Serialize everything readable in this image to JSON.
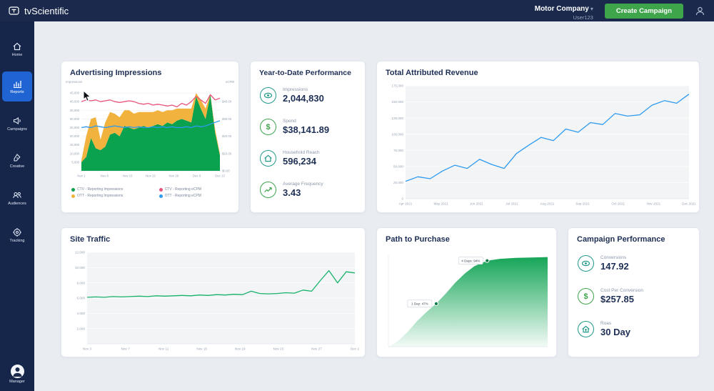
{
  "colors": {
    "topbar_navy": "#1b2a4c",
    "sidebar_navy": "#16264b",
    "active_blue": "#2064d4",
    "button_green": "#3fa54a",
    "icon_teal": "#21998a",
    "icon_green": "#3ea34d",
    "chart_green": "#0aa14f",
    "chart_yellow": "#f2b23e",
    "chart_pink": "#e8537a",
    "chart_blue": "#2e9bf0",
    "background": "#e9edf2"
  },
  "topbar": {
    "brand": "tvScientific",
    "account_name": "Motor Company",
    "account_user": "User123",
    "create_campaign_label": "Create Campaign"
  },
  "sidebar": {
    "items": [
      {
        "label": "Home",
        "active": false
      },
      {
        "label": "Reports",
        "active": true
      },
      {
        "label": "Campaigns",
        "active": false
      },
      {
        "label": "Creative",
        "active": false
      },
      {
        "label": "Audiences",
        "active": false
      },
      {
        "label": "Tracking",
        "active": false
      }
    ],
    "manager_label": "Manager"
  },
  "ytd": {
    "title": "Year-to-Date Performance",
    "stats": [
      {
        "label": "Impressions",
        "value": "2,044,830",
        "icon": "eye"
      },
      {
        "label": "Spend",
        "value": "$38,141.89",
        "icon": "dollar"
      },
      {
        "label": "Household Reach",
        "value": "596,234",
        "icon": "house"
      },
      {
        "label": "Average Frequency",
        "value": "3.43",
        "icon": "trend"
      }
    ]
  },
  "campaign_performance": {
    "title": "Campaign Performance",
    "stats": [
      {
        "label": "Conversions",
        "value": "147.92",
        "icon": "eye"
      },
      {
        "label": "Cost Per Conversion",
        "value": "$257.85",
        "icon": "dollar"
      },
      {
        "label": "Roas",
        "value": "30 Day",
        "icon": "house-up"
      }
    ]
  },
  "chart_data": {
    "advertising_impressions": {
      "type": "area+line",
      "title": "Advertising Impressions",
      "ylabel_left": "Impressions",
      "ylabel_right": "eCPM",
      "x_ticks": [
        "Nov 1",
        "Nov 8",
        "Nov 15",
        "Nov 22",
        "Nov 29",
        "Dec 6",
        "Dec 13"
      ],
      "y_left": {
        "min": 0,
        "max": 50000,
        "ticks": [
          {
            "v": 5000,
            "label": "5,000"
          },
          {
            "v": 10000,
            "label": "10,000"
          },
          {
            "v": 15000,
            "label": "15,000"
          },
          {
            "v": 20000,
            "label": "20,000"
          },
          {
            "v": 25000,
            "label": "25,000"
          },
          {
            "v": 30000,
            "label": "30,000"
          },
          {
            "v": 35000,
            "label": "35,000"
          },
          {
            "v": 40000,
            "label": "40,000"
          },
          {
            "v": 45000,
            "label": "45,000"
          }
        ]
      },
      "y_right": {
        "min": 0,
        "max": 50,
        "ticks": [
          {
            "v": 0,
            "label": "$0.00"
          },
          {
            "v": 10,
            "label": "$10.00"
          },
          {
            "v": 20,
            "label": "$20.00"
          },
          {
            "v": 30,
            "label": "$30.00"
          },
          {
            "v": 40,
            "label": "$40.00"
          }
        ]
      },
      "series": [
        {
          "name": "CTV - Reporting Impressions",
          "type": "area",
          "stack": true,
          "color": "#0aa14f",
          "values": [
            5000,
            8000,
            19000,
            13000,
            12000,
            14000,
            21000,
            22000,
            20000,
            26000,
            25000,
            24000,
            25000,
            26000,
            25000,
            26000,
            27000,
            26000,
            28000,
            27000,
            29000,
            30000,
            29000,
            28000,
            43000,
            36000,
            30000,
            44000,
            22000,
            9000
          ]
        },
        {
          "name": "OTT - Reporting Impressions",
          "type": "area",
          "stack": true,
          "color": "#f2b23e",
          "values": [
            1000,
            12000,
            11000,
            18000,
            6000,
            14000,
            13000,
            11000,
            11000,
            9000,
            10000,
            9000,
            9000,
            8000,
            9000,
            8000,
            8000,
            8000,
            7000,
            8000,
            7000,
            6000,
            7000,
            8000,
            2000,
            5000,
            6000,
            500,
            2000,
            1000
          ]
        },
        {
          "name": "CTV - Reporting eCPM",
          "type": "line",
          "axis": "right",
          "color": "#e8537a",
          "values": [
            40,
            41,
            40.5,
            41,
            40,
            40.5,
            41,
            40,
            39.5,
            40,
            40.5,
            40,
            39,
            38.5,
            39,
            38,
            38.5,
            38,
            37.5,
            38,
            37,
            39,
            38,
            40,
            43,
            41,
            39,
            44,
            41,
            42
          ]
        },
        {
          "name": "OTT - Reporting eCPM",
          "type": "line",
          "axis": "right",
          "color": "#2e9bf0",
          "values": [
            25,
            25.5,
            25,
            26,
            25.5,
            25,
            25.5,
            26,
            25.5,
            25,
            25.5,
            25,
            25.5,
            25,
            25,
            25.5,
            25,
            25.5,
            25,
            25.5,
            25,
            25,
            25.5,
            25,
            26,
            25.5,
            26,
            27,
            28,
            29
          ]
        }
      ],
      "legend": [
        {
          "label": "CTV - Reporting Impressions",
          "color": "#0aa14f"
        },
        {
          "label": "CTV - Reporting eCPM",
          "color": "#e8537a"
        },
        {
          "label": "OTT - Reporting Impressions",
          "color": "#f2b23e"
        },
        {
          "label": "OTT - Reporting eCPM",
          "color": "#2e9bf0"
        }
      ]
    },
    "total_attributed_revenue": {
      "type": "line",
      "title": "Total Attributed Revenue",
      "color": "#2e9bf0",
      "x_ticks": [
        "Apr 2021",
        "May 2021",
        "Jun 2021",
        "Jul 2021",
        "Aug 2021",
        "Sep 2021",
        "Oct 2021",
        "Nov 2021",
        "Dec 2021"
      ],
      "y_left": {
        "min": 0,
        "max": 175000,
        "ticks": [
          {
            "v": 0,
            "label": "0"
          },
          {
            "v": 25000,
            "label": "25,000"
          },
          {
            "v": 50000,
            "label": "50,000"
          },
          {
            "v": 75000,
            "label": "75,000"
          },
          {
            "v": 100000,
            "label": "100,000"
          },
          {
            "v": 125000,
            "label": "125,000"
          },
          {
            "v": 150000,
            "label": "150,000"
          },
          {
            "v": 175000,
            "label": "175,000"
          }
        ]
      },
      "series": [
        {
          "name": "Attributed Revenue",
          "type": "line",
          "color": "#2e9bf0",
          "values": [
            27000,
            34000,
            31000,
            43000,
            52000,
            47000,
            61000,
            53000,
            47000,
            70000,
            83000,
            95000,
            90000,
            108000,
            103000,
            118000,
            115000,
            132000,
            128000,
            130000,
            145000,
            152000,
            148000,
            162000
          ]
        }
      ]
    },
    "site_traffic": {
      "type": "line",
      "title": "Site Traffic",
      "color": "#17b26b",
      "x_ticks": [
        "Nov 3",
        "Nov 7",
        "Nov 11",
        "Nov 15",
        "Nov 19",
        "Nov 23",
        "Nov 27",
        "Dec 2"
      ],
      "y_left": {
        "min": 0,
        "max": 12000,
        "ticks": [
          {
            "v": 2000,
            "label": "2,000"
          },
          {
            "v": 4000,
            "label": "4,000"
          },
          {
            "v": 6000,
            "label": "6,000"
          },
          {
            "v": 8000,
            "label": "8,000"
          },
          {
            "v": 10000,
            "label": "10,000"
          },
          {
            "v": 12000,
            "label": "12,000"
          }
        ]
      },
      "series": [
        {
          "name": "Site Visits",
          "type": "line",
          "color": "#17b26b",
          "values": [
            6100,
            6150,
            6100,
            6200,
            6150,
            6200,
            6250,
            6200,
            6300,
            6250,
            6300,
            6350,
            6300,
            6400,
            6350,
            6450,
            6400,
            6500,
            6450,
            6900,
            6600,
            6550,
            6600,
            6700,
            6650,
            7050,
            6900,
            8300,
            9600,
            8000,
            9450,
            9300
          ]
        }
      ]
    },
    "path_to_purchase": {
      "type": "area",
      "title": "Path to Purchase",
      "color": "#0aa14f",
      "unit": "percent_of_conversions",
      "points": [
        {
          "x": 0,
          "y": 0
        },
        {
          "x": 0.06,
          "y": 6
        },
        {
          "x": 0.12,
          "y": 16
        },
        {
          "x": 0.18,
          "y": 28
        },
        {
          "x": 0.24,
          "y": 38
        },
        {
          "x": 0.3,
          "y": 47
        },
        {
          "x": 0.36,
          "y": 58
        },
        {
          "x": 0.42,
          "y": 70
        },
        {
          "x": 0.48,
          "y": 80
        },
        {
          "x": 0.54,
          "y": 88
        },
        {
          "x": 0.62,
          "y": 94
        },
        {
          "x": 0.7,
          "y": 96
        },
        {
          "x": 0.8,
          "y": 97
        },
        {
          "x": 0.9,
          "y": 97.5
        },
        {
          "x": 1,
          "y": 98
        }
      ],
      "annotations": [
        {
          "x": 0.3,
          "label": "1 Day: 47%"
        },
        {
          "x": 0.62,
          "label": "4 Days: 94%"
        }
      ]
    }
  }
}
